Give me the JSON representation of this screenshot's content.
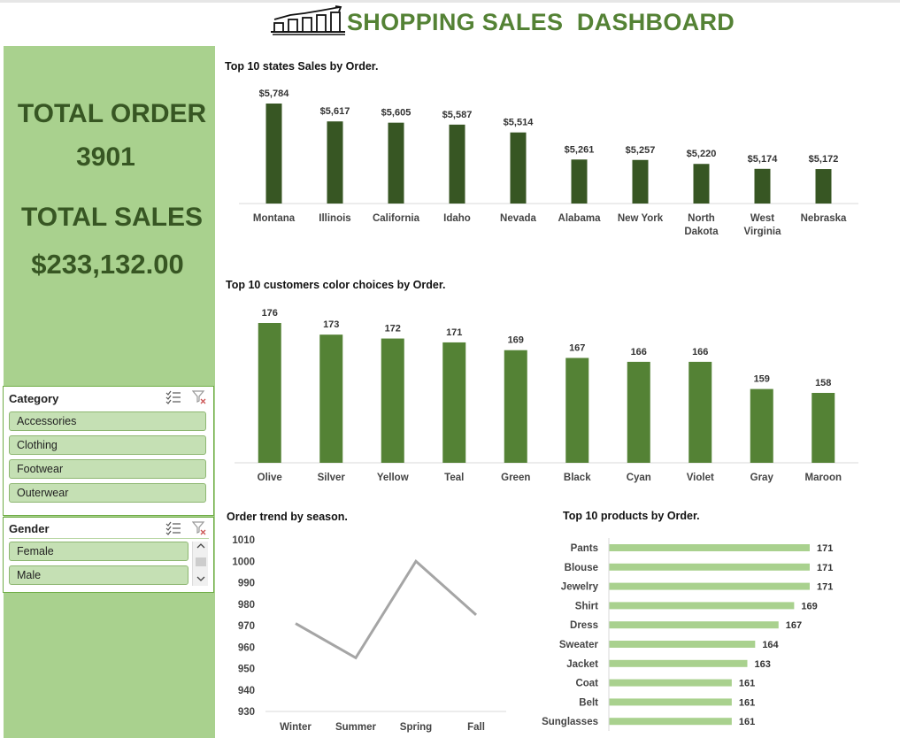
{
  "header": {
    "title": "SHOPPING SALES  DASHBOARD",
    "icon": "bar-chart-trend-icon"
  },
  "kpis": {
    "total_order_label": "TOTAL ORDER",
    "total_order_value": "3901",
    "total_sales_label": "TOTAL SALES",
    "total_sales_value": "$233,132.00"
  },
  "slicers": {
    "category": {
      "title": "Category",
      "items": [
        "Accessories",
        "Clothing",
        "Footwear",
        "Outerwear"
      ]
    },
    "gender": {
      "title": "Gender",
      "items": [
        "Female",
        "Male"
      ]
    }
  },
  "colors": {
    "accent": "#548235",
    "sidebar": "#a9d18e",
    "states_bar": "#375623",
    "color_bar": "#548235",
    "product_bar": "#a9d18e",
    "line": "#a5a5a5"
  },
  "chart_data": [
    {
      "id": "states",
      "type": "bar",
      "title": "Top 10 states Sales by Order.",
      "categories": [
        [
          "Montana"
        ],
        [
          "Illinois"
        ],
        [
          "California"
        ],
        [
          "Idaho"
        ],
        [
          "Nevada"
        ],
        [
          "Alabama"
        ],
        [
          "New York"
        ],
        [
          "North",
          "Dakota"
        ],
        [
          "West",
          "Virginia"
        ],
        [
          "Nebraska"
        ]
      ],
      "values": [
        5784,
        5617,
        5605,
        5587,
        5514,
        5261,
        5257,
        5220,
        5174,
        5172
      ],
      "labels": [
        "$5,784",
        "$5,617",
        "$5,605",
        "$5,587",
        "$5,514",
        "$5,261",
        "$5,257",
        "$5,220",
        "$5,174",
        "$5,172"
      ],
      "ylim": [
        4850,
        5784
      ]
    },
    {
      "id": "colors",
      "type": "bar",
      "title": "Top 10 customers color choices by Order.",
      "categories": [
        [
          "Olive"
        ],
        [
          "Silver"
        ],
        [
          "Yellow"
        ],
        [
          "Teal"
        ],
        [
          "Green"
        ],
        [
          "Black"
        ],
        [
          "Cyan"
        ],
        [
          "Violet"
        ],
        [
          "Gray"
        ],
        [
          "Maroon"
        ]
      ],
      "values": [
        176,
        173,
        172,
        171,
        169,
        167,
        166,
        166,
        159,
        158
      ],
      "labels": [
        "176",
        "173",
        "172",
        "171",
        "169",
        "167",
        "166",
        "166",
        "159",
        "158"
      ],
      "ylim": [
        140,
        176
      ]
    },
    {
      "id": "season",
      "type": "line",
      "title": "Order trend by season.",
      "categories": [
        "Winter",
        "Summer",
        "Spring",
        "Fall"
      ],
      "values": [
        971,
        955,
        1000,
        975
      ],
      "yticks": [
        930,
        940,
        950,
        960,
        970,
        980,
        990,
        1000,
        1010
      ],
      "ylim": [
        930,
        1010
      ]
    },
    {
      "id": "products",
      "type": "bar",
      "orientation": "horizontal",
      "title": "Top 10 products by Order.",
      "categories": [
        "Pants",
        "Blouse",
        "Jewelry",
        "Shirt",
        "Dress",
        "Sweater",
        "Jacket",
        "Coat",
        "Belt",
        "Sunglasses"
      ],
      "values": [
        171,
        171,
        171,
        169,
        167,
        164,
        163,
        161,
        161,
        161
      ],
      "labels": [
        "171",
        "171",
        "171",
        "169",
        "167",
        "164",
        "163",
        "161",
        "161",
        "161"
      ],
      "xlim": [
        155,
        171
      ]
    }
  ]
}
